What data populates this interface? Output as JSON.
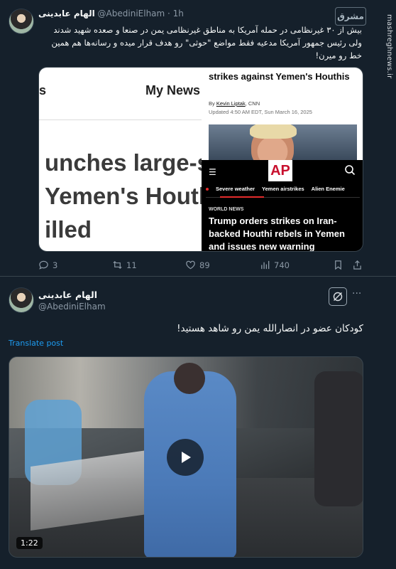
{
  "tweet1": {
    "name": "الهام عابدینی",
    "handle": "@AbediniElham",
    "time": "· 1h",
    "text": "بیش از ۳۰ غیرنظامی در حمله آمریکا به مناطق غیرنظامی یمن در صنعا و صعده شهید شدند ولی رئیس جمهور آمریکا مدعیه فقط مواضع \"حوثی\" رو هدف قرار میده و رسانه‌ها هم همین خط رو میرن!",
    "media": {
      "left": {
        "nav_label": "My News",
        "nav_left_fragment": "s",
        "headline_lines": [
          "unches large-sc",
          " Yemen's Houth",
          "illed"
        ]
      },
      "cnn": {
        "title": "strikes against Yemen's Houthis",
        "by_prefix": "By",
        "author": "Kevin Liptak",
        "outlet": ", CNN",
        "updated": "Updated 4:50 AM EDT, Sun March 16, 2025"
      },
      "ap": {
        "logo": "AP",
        "nav_items": [
          "Severe weather",
          "Yemen airstrikes",
          "Alien Enemie"
        ],
        "kicker": "WORLD NEWS",
        "headline": "Trump orders strikes on Iran-backed Houthi rebels in Yemen and issues new warning"
      }
    },
    "stats": {
      "replies": "3",
      "reposts": "11",
      "likes": "89",
      "views": "740"
    }
  },
  "tweet2": {
    "name": "الهام عابدینی",
    "handle": "@AbediniElham",
    "text": "کودکان عضو در انصارالله یمن رو شاهد هستید!",
    "translate": "Translate post",
    "video_duration": "1:22"
  },
  "watermark": "mashreghnews.ir",
  "brand_mark": "مشرق"
}
